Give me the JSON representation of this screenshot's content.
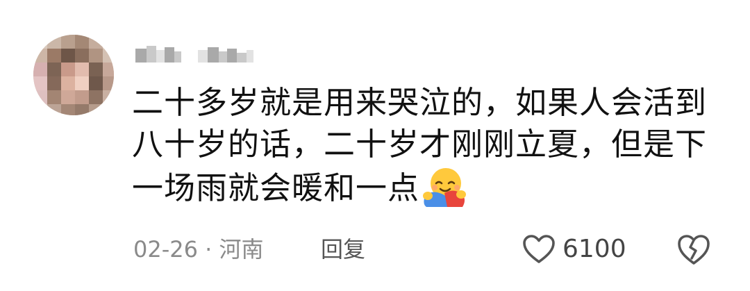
{
  "comment": {
    "text_lines": [
      "二十多岁就是用来哭泣的，如果人会活到",
      "八十岁的话，二十岁才刚刚立夏，但是下",
      "一场雨就会暖和一点"
    ],
    "emoji": "hug-emoji",
    "meta": "02-26 · 河南",
    "reply_label": "回复",
    "like_count": "6100"
  },
  "colors": {
    "text": "#111111",
    "meta": "#8a8a8a",
    "icon": "#555555"
  }
}
